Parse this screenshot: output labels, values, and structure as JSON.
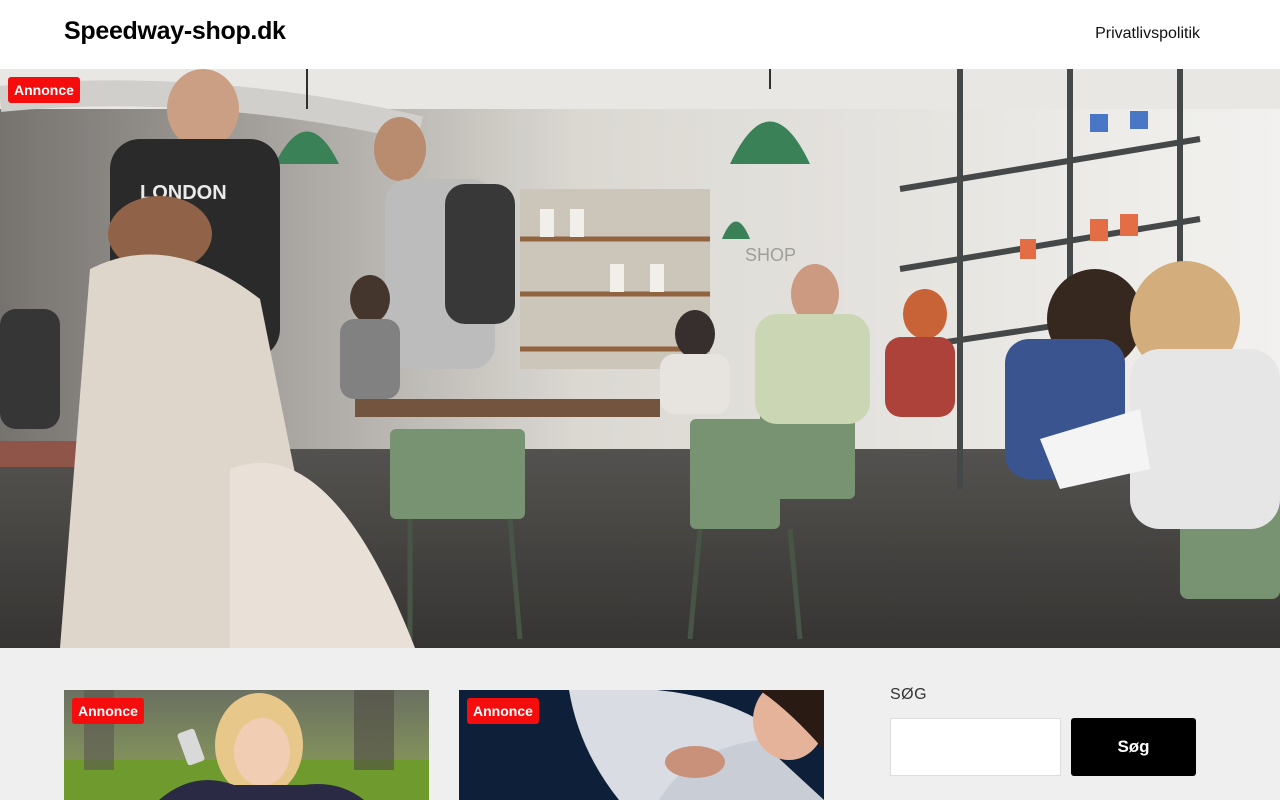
{
  "header": {
    "site_title": "Speedway-shop.dk",
    "nav": [
      {
        "label": "Privatlivspolitik"
      }
    ]
  },
  "hero": {
    "badge": "Annonce",
    "image": "photo of people in a busy cafe shop"
  },
  "posts": [
    {
      "badge": "Annonce",
      "image": "woman taking a selfie outdoors"
    },
    {
      "badge": "Annonce",
      "image": "couple embracing close-up"
    }
  ],
  "sidebar": {
    "search": {
      "heading": "SØG",
      "placeholder": "",
      "value": "",
      "button_label": "Søg"
    }
  },
  "colors": {
    "badge_red": "#f50d0d",
    "button_black": "#000000",
    "page_bg": "#efefef"
  }
}
